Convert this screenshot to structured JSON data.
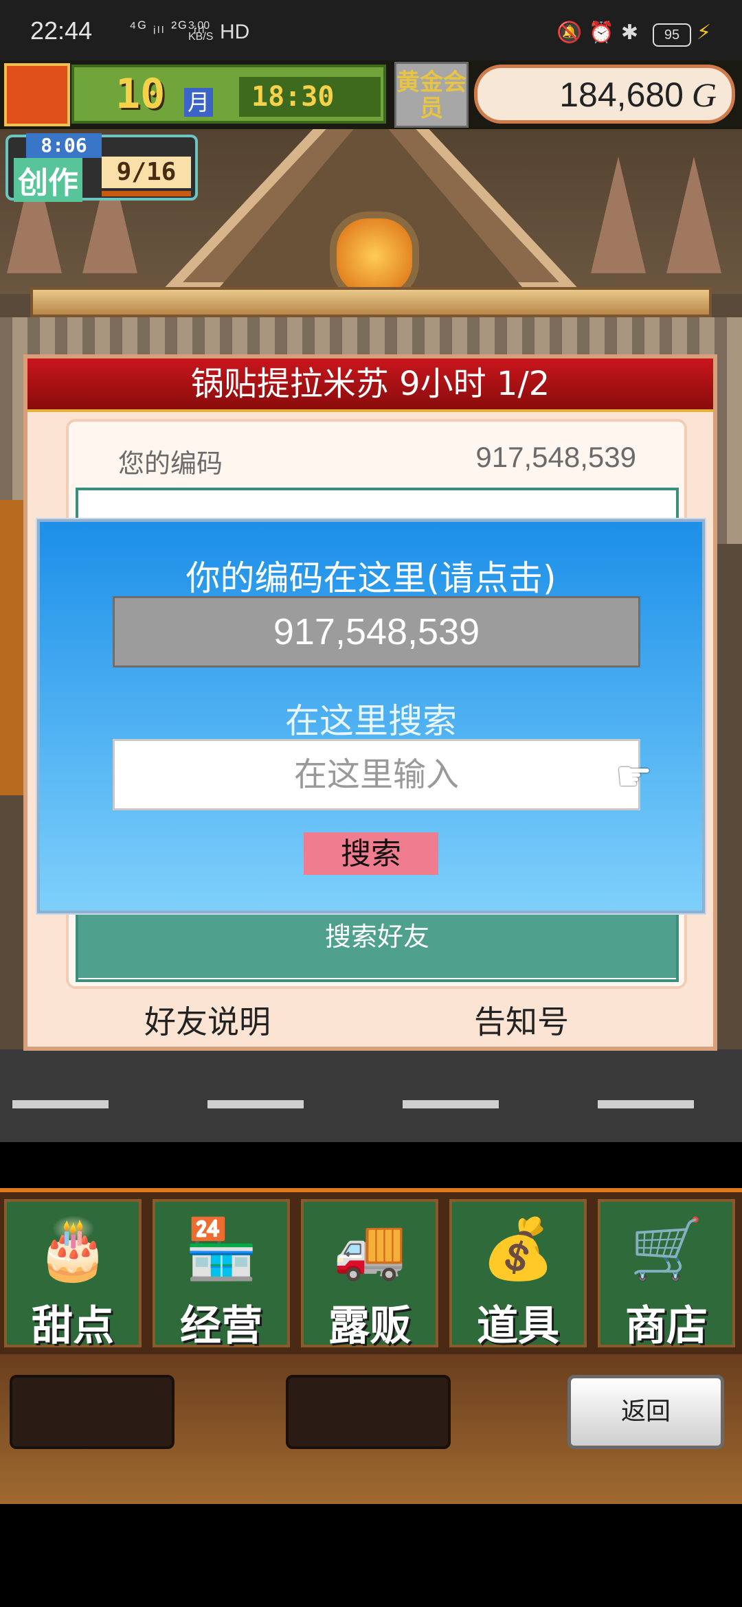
{
  "status_bar": {
    "time": "22:44",
    "network": "⁴ᴳ ᵢₗₗ ²ᴳ ᵢₗₗ",
    "speed_value": "3.00",
    "speed_unit": "KB/S",
    "hd": "HD",
    "battery": "95"
  },
  "hud": {
    "month": "10",
    "month_unit": "月",
    "clock": "18:30",
    "member_label": "黄金会员",
    "money": "184,680",
    "currency": "G"
  },
  "create_badge": {
    "countdown": "8:06",
    "label": "创作",
    "count": "9/16"
  },
  "panel": {
    "title": "锅贴提拉米苏 9小时 1/2",
    "code_label": "您的编码",
    "code_value": "917,548,539",
    "search_friend": "搜索好友",
    "explain_button": "好友说明",
    "notify_button": "告知号"
  },
  "dialog": {
    "title": "你的编码在这里(请点击)",
    "code": "917,548,539",
    "search_label": "在这里搜索",
    "input_placeholder": "在这里输入",
    "input_value": "",
    "search_button": "搜索"
  },
  "menu": {
    "items": [
      {
        "label": "甜点",
        "icon": "cake-icon"
      },
      {
        "label": "经营",
        "icon": "shop-icon"
      },
      {
        "label": "露贩",
        "icon": "truck-icon"
      },
      {
        "label": "道具",
        "icon": "items-icon"
      },
      {
        "label": "商店",
        "icon": "cart-icon"
      }
    ]
  },
  "back_button": "返回",
  "colors": {
    "dialog_top": "#1c8fe8",
    "panel_title": "#c8161c",
    "search_button": "#f07c90"
  }
}
